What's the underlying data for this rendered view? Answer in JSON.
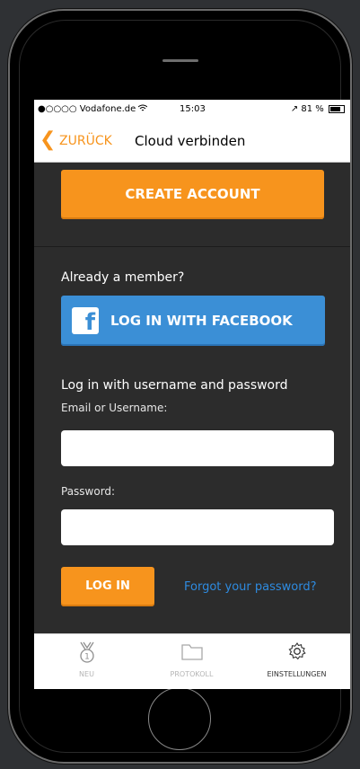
{
  "statusbar": {
    "carrier": "●○○○○ Vodafone.de",
    "wifi_icon": "wifi-icon",
    "time": "15:03",
    "right": "↗ 81 %",
    "battery_icon": "battery-icon"
  },
  "navbar": {
    "back_label": "ZURÜCK",
    "back_icon": "chevron-left-icon",
    "title": "Cloud verbinden"
  },
  "main": {
    "create_account_label": "CREATE ACCOUNT",
    "member_label": "Already a member?",
    "facebook_label": "LOG IN WITH FACEBOOK",
    "login_heading": "Log in with username and password",
    "email_label": "Email or Username:",
    "email_value": "",
    "password_label": "Password:",
    "password_value": "",
    "login_label": "LOG IN",
    "forgot_label": "Forgot your password?"
  },
  "tabbar": {
    "items": [
      {
        "label": "NEU",
        "icon": "medal-icon"
      },
      {
        "label": "PROTOKOLL",
        "icon": "folder-icon"
      },
      {
        "label": "EINSTELLUNGEN",
        "icon": "gear-icon"
      }
    ],
    "selected": "EINSTELLUNGEN"
  },
  "colors": {
    "accent": "#f7941d",
    "facebook": "#3b8fd6",
    "link": "#2e8be0",
    "background": "#2c2c2c"
  }
}
